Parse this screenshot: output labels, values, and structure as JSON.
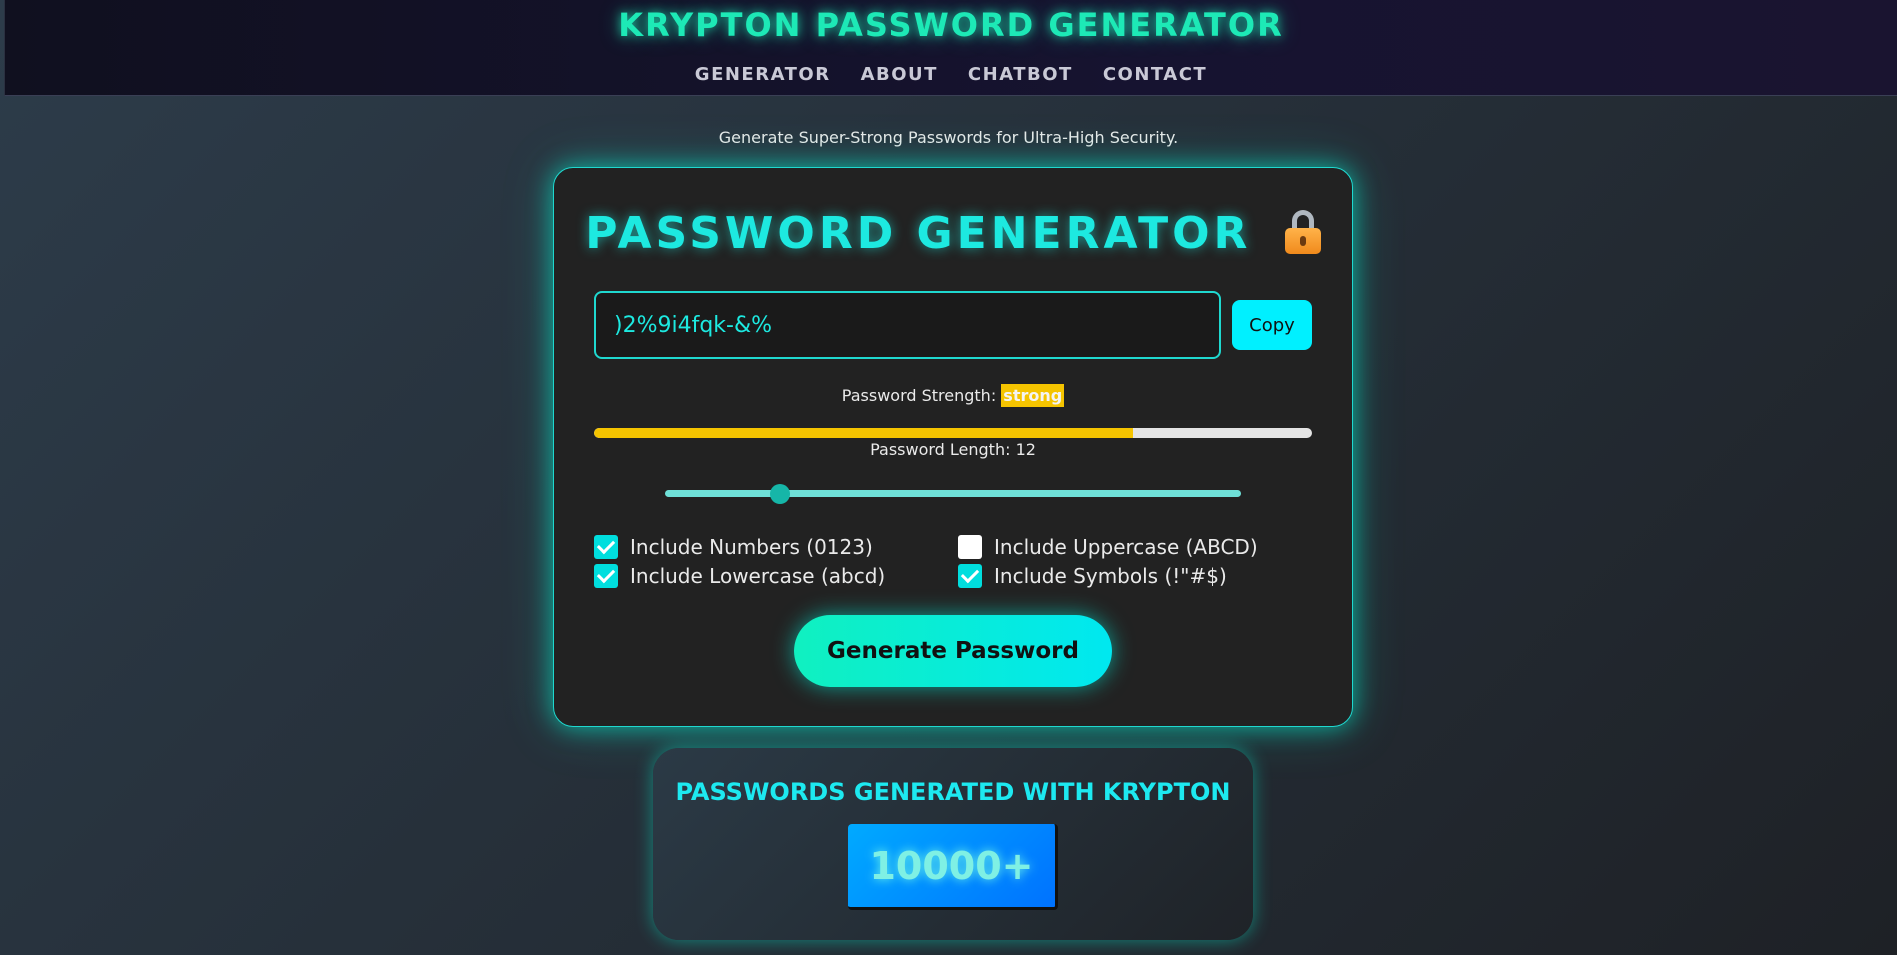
{
  "header": {
    "title": "KRYPTON PASSWORD GENERATOR",
    "nav": [
      "GENERATOR",
      "ABOUT",
      "CHATBOT",
      "CONTACT"
    ]
  },
  "tagline": "Generate Super-Strong Passwords for Ultra-High Security.",
  "generator": {
    "title": "PASSWORD GENERATOR",
    "lock_icon": "lock-icon",
    "password_value": ")2%9i4fqk-&%",
    "copy_label": "Copy",
    "strength_label": "Password Strength:",
    "strength_value": "strong",
    "strength_fraction": 0.75,
    "strength_color": "#f5c400",
    "length_label": "Password Length: 12",
    "length_value": 12,
    "slider_fraction": 0.2,
    "options": [
      {
        "label": "Include Numbers (0123)",
        "checked": true
      },
      {
        "label": "Include Uppercase (ABCD)",
        "checked": false
      },
      {
        "label": "Include Lowercase (abcd)",
        "checked": true
      },
      {
        "label": "Include Symbols (!\"#$)",
        "checked": true
      }
    ],
    "generate_label": "Generate Password"
  },
  "counter": {
    "title": "PASSWORDS GENERATED WITH KRYPTON",
    "value": "10000+"
  },
  "colors": {
    "accent": "#1de9e0",
    "title_green": "#1de9b6",
    "counter_blue": "#0088ff"
  }
}
